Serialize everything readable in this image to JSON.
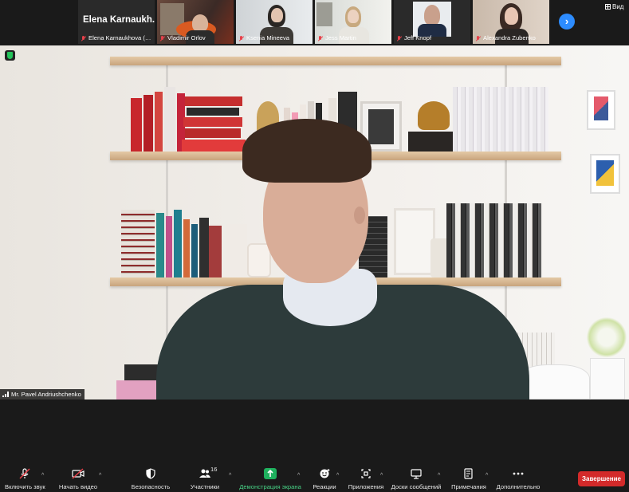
{
  "top_strip": {
    "name_card": {
      "name": "Elena  Karnaukh...",
      "label": "Elena Karnaukhova (PIR..."
    },
    "participants": [
      {
        "name": "Vladimir Orlov"
      },
      {
        "name": "Ksenia Mineeva"
      },
      {
        "name": "Jess Martin"
      },
      {
        "name": "Jeff Knopf"
      },
      {
        "name": "Alexandra Zubenko"
      }
    ],
    "next_icon": "chevron-right-icon",
    "view_label": "Вид"
  },
  "main_video": {
    "speaker_label": "Mr. Pavel Andriushchenko",
    "security_icon": "shield-icon"
  },
  "toolbar": {
    "unmute": "Включить звук",
    "start_video": "Начать видео",
    "security": "Безопасность",
    "participants": "Участники",
    "participants_count": "16",
    "share_screen": "Демонстрация экрана",
    "reactions": "Реакции",
    "apps": "Приложения",
    "whiteboards": "Доски сообщений",
    "notes": "Примечания",
    "more": "Дополнительно",
    "end": "Завершение"
  },
  "colors": {
    "accent_blue": "#2d8cff",
    "end_red": "#d32a2a",
    "share_green": "#1fb15e",
    "muted_red": "#e8414a"
  }
}
